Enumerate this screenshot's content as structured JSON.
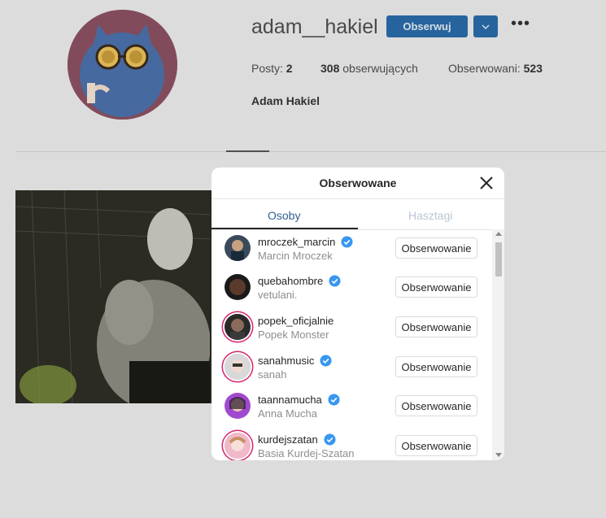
{
  "profile": {
    "username": "adam__hakiel",
    "follow_label": "Obserwuj",
    "dropdown_icon": "chevron-down-icon",
    "more_icon": "more-icon",
    "posts_label": "Posty:",
    "posts_value": "2",
    "followers_value": "308",
    "followers_label": "obserwujących",
    "following_label": "Obserwowani:",
    "following_value": "523",
    "full_name": "Adam Hakiel"
  },
  "modal": {
    "title": "Obserwowane",
    "close_icon": "close-icon",
    "tabs": [
      {
        "label": "Osoby",
        "active": true
      },
      {
        "label": "Hasztagi",
        "active": false
      }
    ],
    "rows": [
      {
        "username": "mroczek_marcin",
        "name": "Marcin Mroczek",
        "verified": true,
        "ring": false,
        "button": "Obserwowanie"
      },
      {
        "username": "quebahombre",
        "name": "vetulani.",
        "verified": true,
        "ring": false,
        "button": "Obserwowanie"
      },
      {
        "username": "popek_oficjalnie",
        "name": "Popek Monster",
        "verified": false,
        "ring": true,
        "button": "Obserwowanie"
      },
      {
        "username": "sanahmusic",
        "name": "sanah",
        "verified": true,
        "ring": true,
        "button": "Obserwowanie"
      },
      {
        "username": "taannamucha",
        "name": "Anna Mucha",
        "verified": true,
        "ring": false,
        "button": "Obserwowanie"
      },
      {
        "username": "kurdejszatan",
        "name": "Basia Kurdej-Szatan",
        "verified": true,
        "ring": true,
        "button": "Obserwowanie"
      }
    ]
  },
  "colors": {
    "accent": "#2a6aa6",
    "verified": "#3897f0",
    "story_ring": "#d6246e"
  }
}
